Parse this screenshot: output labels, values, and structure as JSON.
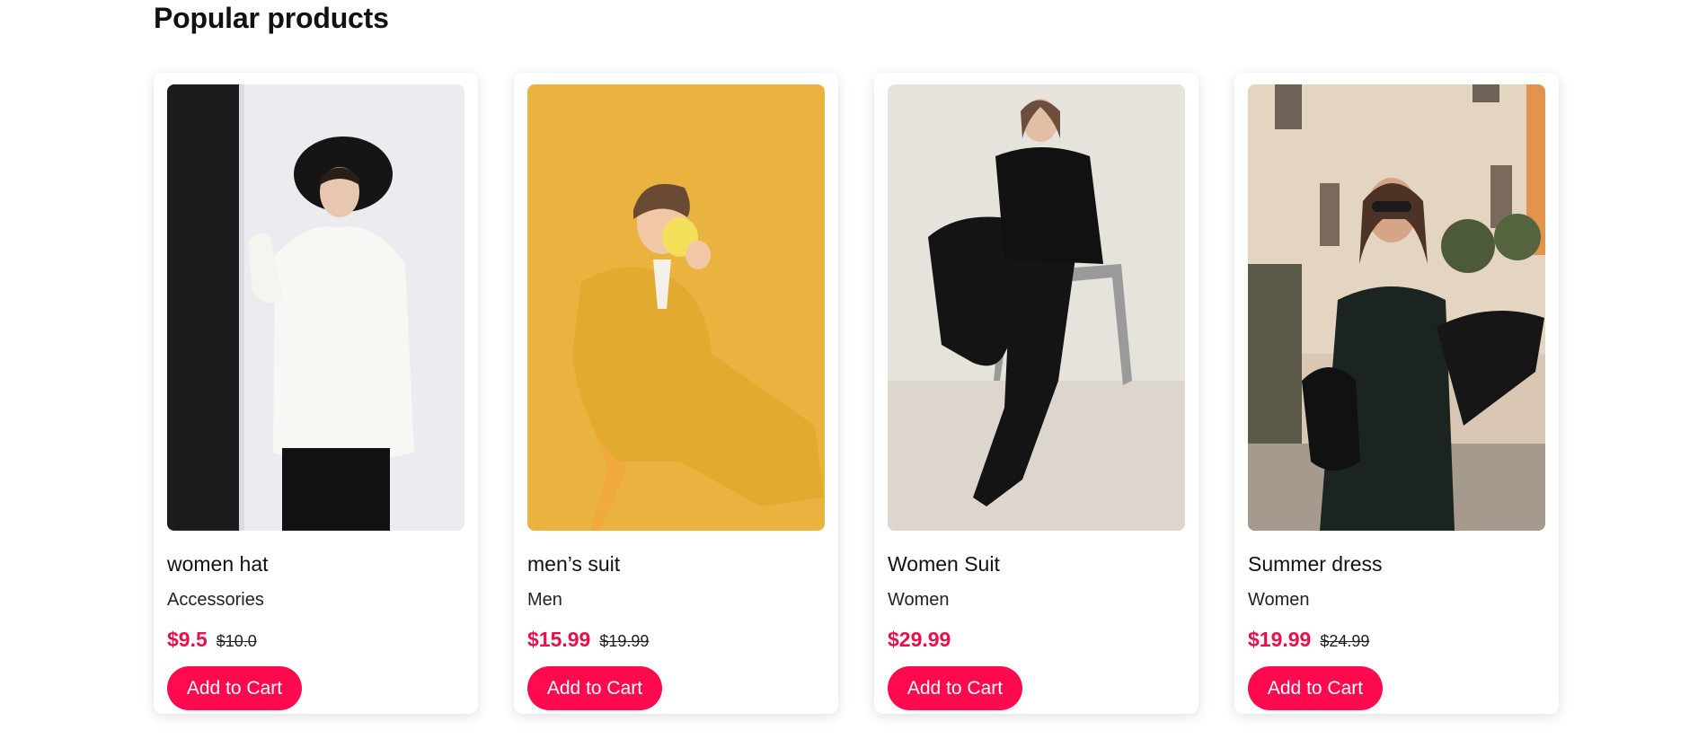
{
  "section": {
    "title": "Popular products"
  },
  "products": [
    {
      "name": "women hat",
      "category": "Accessories",
      "price": "$9.5",
      "old_price": "$10.0",
      "button": "Add to Cart",
      "image": "woman-in-black-hat-white-shirt-photo"
    },
    {
      "name": "men’s suit",
      "category": "Men",
      "price": "$15.99",
      "old_price": "$19.99",
      "button": "Add to Cart",
      "image": "man-in-yellow-suit-drinking-from-cup-photo"
    },
    {
      "name": "Women Suit",
      "category": "Women",
      "price": "$29.99",
      "old_price": "",
      "button": "Add to Cart",
      "image": "woman-in-black-suit-on-chair-photo"
    },
    {
      "name": "Summer dress",
      "category": "Women",
      "price": "$19.99",
      "old_price": "$24.99",
      "button": "Add to Cart",
      "image": "woman-in-black-slip-dress-sunglasses-photo"
    }
  ],
  "colors": {
    "accent": "#ff0a4e",
    "price": "#e8104a"
  }
}
